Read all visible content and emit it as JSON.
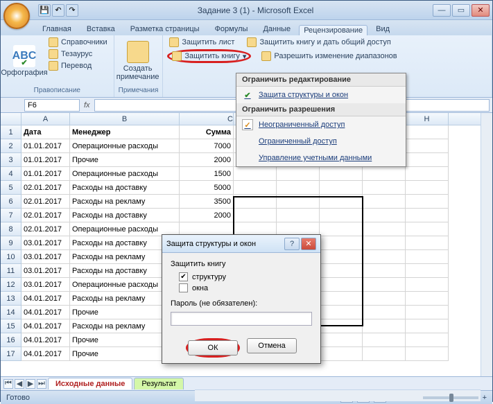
{
  "title": "Задание 3 (1) - Microsoft Excel",
  "tabs": [
    "Главная",
    "Вставка",
    "Разметка страницы",
    "Формулы",
    "Данные",
    "Рецензирование",
    "Вид"
  ],
  "active_tab": "Рецензирование",
  "ribbon": {
    "spelling": {
      "big": "Орфография",
      "items": [
        "Справочники",
        "Тезаурус",
        "Перевод"
      ],
      "group": "Правописание"
    },
    "comments": {
      "big": "Создать примечание",
      "group": "Примечания"
    },
    "protect": {
      "sheet": "Защитить лист",
      "book": "Защитить книгу",
      "share": "Защитить книгу и дать общий доступ",
      "ranges": "Разрешить изменение диапазонов"
    }
  },
  "dropdown": {
    "hdr1": "Ограничить редактирование",
    "item1": "Защита структуры и окон",
    "hdr2": "Ограничить разрешения",
    "item2": "Неограниченный доступ",
    "item3": "Ограниченный доступ",
    "item4": "Управление учетными данными"
  },
  "namebox": "F6",
  "columns": [
    "A",
    "B",
    "C",
    "D",
    "E",
    "F",
    "G",
    "H"
  ],
  "headers": {
    "A": "Дата",
    "B": "Менеджер",
    "C": "Сумма"
  },
  "rows": [
    {
      "n": 1,
      "A": "Дата",
      "B": "Менеджер",
      "C": "Сумма",
      "hdr": true
    },
    {
      "n": 2,
      "A": "01.01.2017",
      "B": "Операционные расходы",
      "C": "7000"
    },
    {
      "n": 3,
      "A": "01.01.2017",
      "B": "Прочие",
      "C": "2000"
    },
    {
      "n": 4,
      "A": "01.01.2017",
      "B": "Операционные расходы",
      "C": "1500"
    },
    {
      "n": 5,
      "A": "02.01.2017",
      "B": "Расходы на доставку",
      "C": "5000"
    },
    {
      "n": 6,
      "A": "02.01.2017",
      "B": "Расходы на рекламу",
      "C": "3500"
    },
    {
      "n": 7,
      "A": "02.01.2017",
      "B": "Расходы на доставку",
      "C": "2000"
    },
    {
      "n": 8,
      "A": "02.01.2017",
      "B": "Операционные расходы",
      "C": ""
    },
    {
      "n": 9,
      "A": "03.01.2017",
      "B": "Расходы на доставку",
      "C": ""
    },
    {
      "n": 10,
      "A": "03.01.2017",
      "B": "Расходы на рекламу",
      "C": ""
    },
    {
      "n": 11,
      "A": "03.01.2017",
      "B": "Расходы на доставку",
      "C": ""
    },
    {
      "n": 12,
      "A": "03.01.2017",
      "B": "Операционные расходы",
      "C": ""
    },
    {
      "n": 13,
      "A": "04.01.2017",
      "B": "Расходы на рекламу",
      "C": ""
    },
    {
      "n": 14,
      "A": "04.01.2017",
      "B": "Прочие",
      "C": ""
    },
    {
      "n": 15,
      "A": "04.01.2017",
      "B": "Расходы на рекламу",
      "C": ""
    },
    {
      "n": 16,
      "A": "04.01.2017",
      "B": "Прочие",
      "C": ""
    },
    {
      "n": 17,
      "A": "04.01.2017",
      "B": "Прочие",
      "C": ""
    }
  ],
  "sheets": {
    "s1": "Исходные данные",
    "s2": "Результат"
  },
  "status": {
    "ready": "Готово",
    "zoom": "100%"
  },
  "dialog": {
    "title": "Защита структуры и окон",
    "group": "Защитить книгу",
    "opt1": "структуру",
    "opt2": "окна",
    "pwd": "Пароль (не обязателен):",
    "ok": "ОК",
    "cancel": "Отмена"
  }
}
